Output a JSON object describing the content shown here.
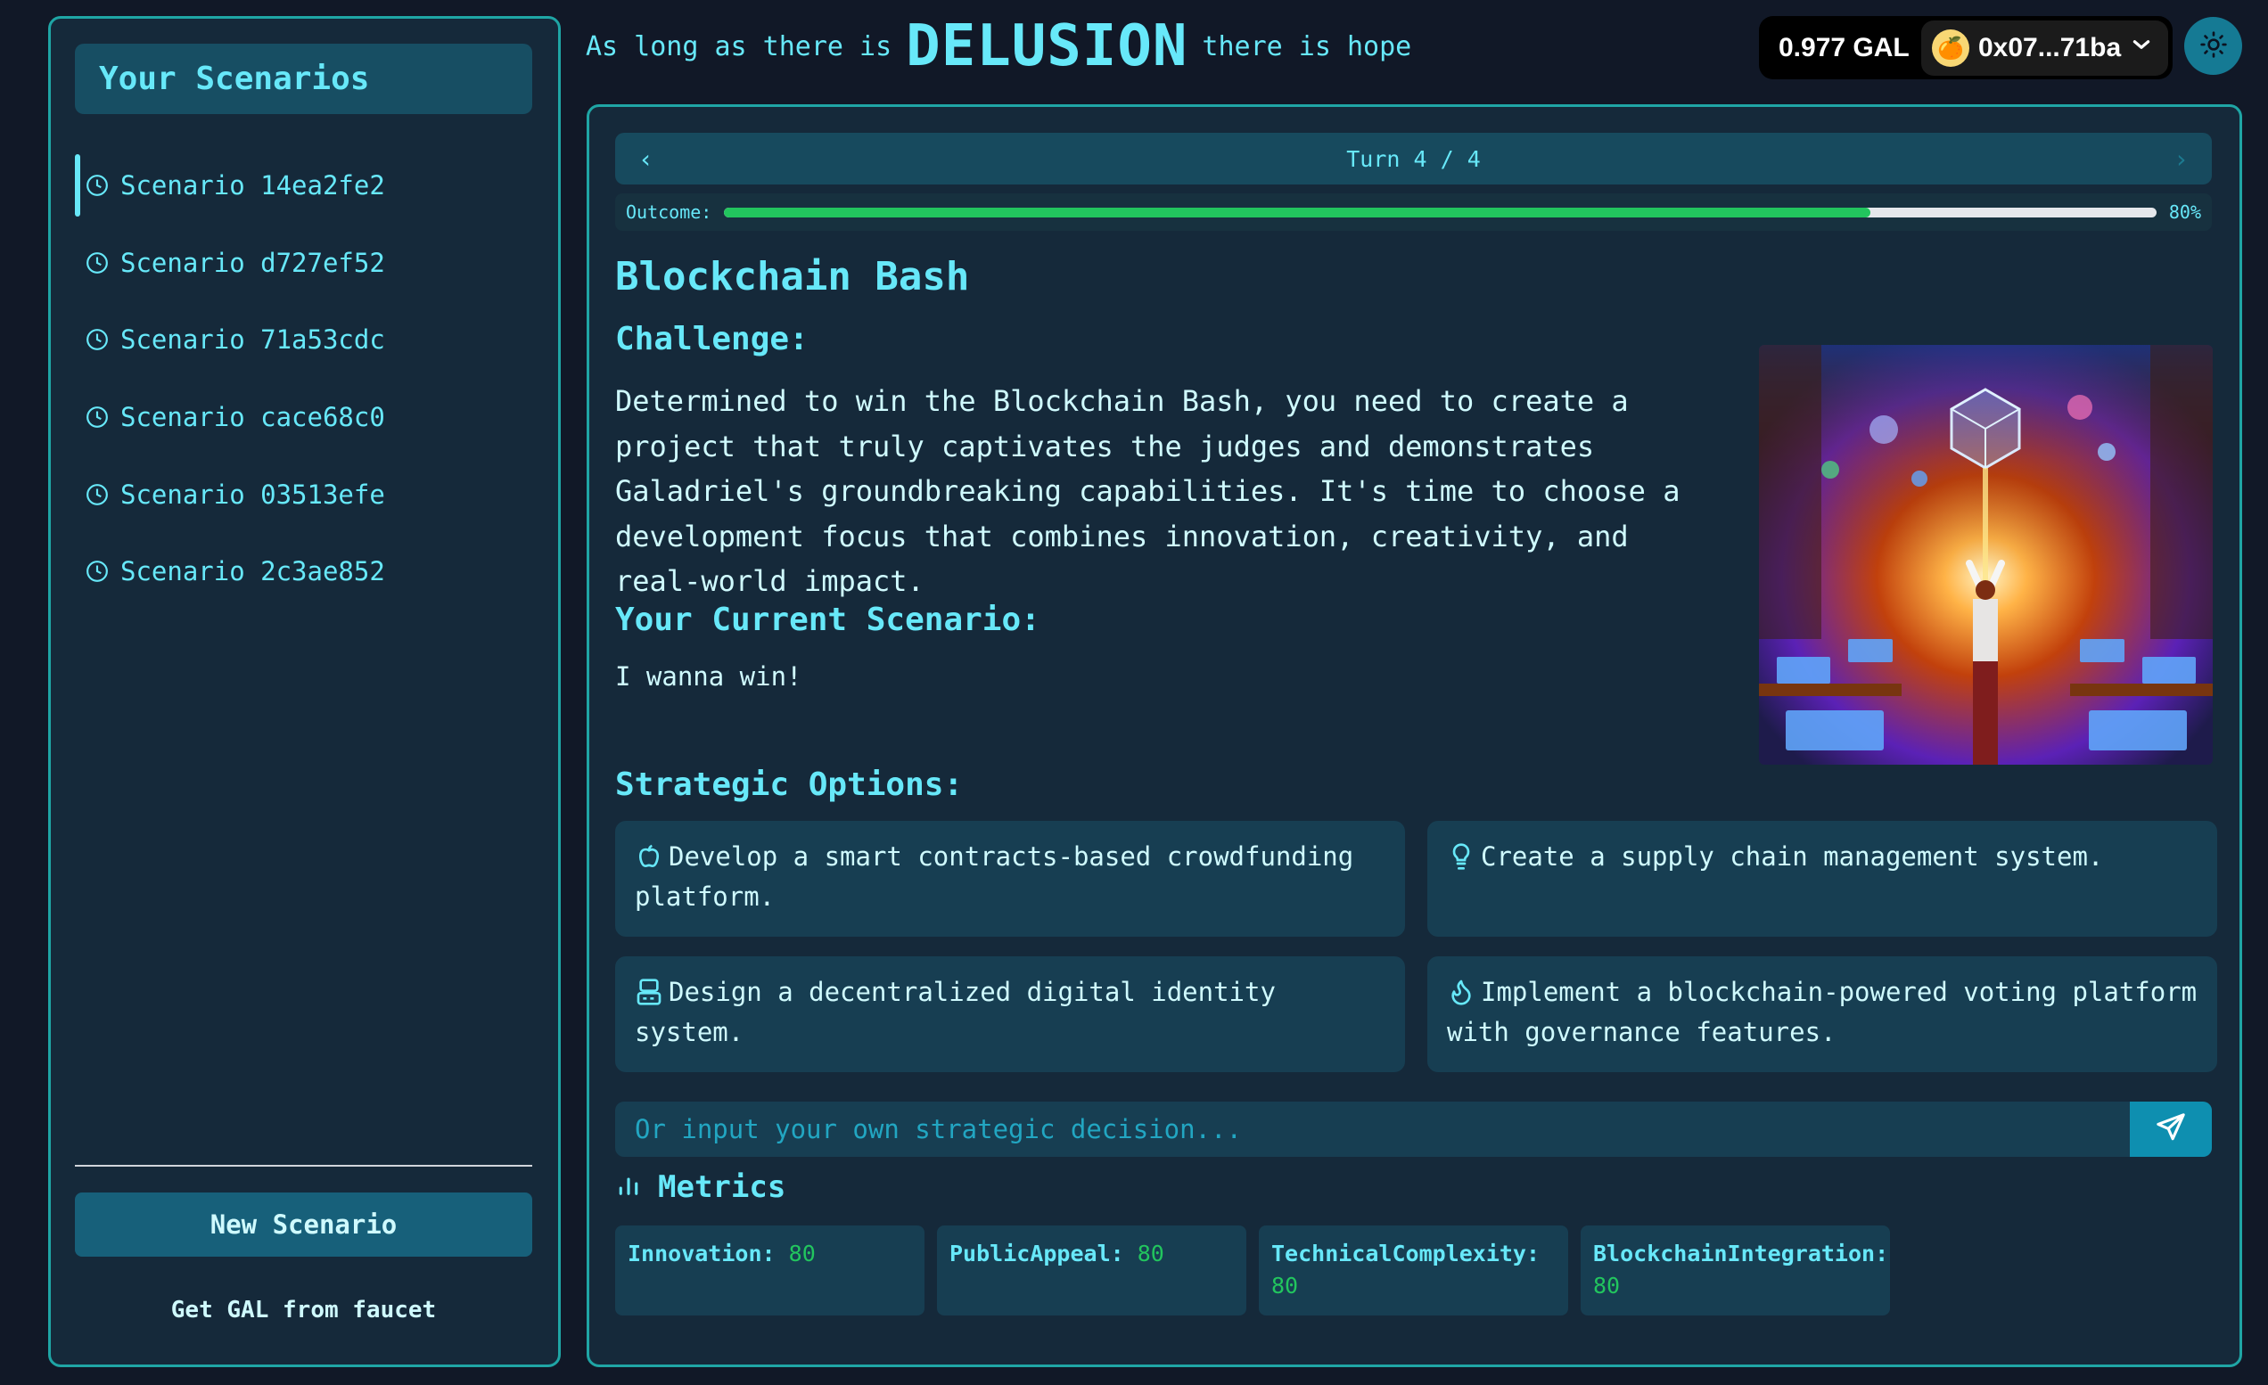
{
  "header": {
    "tagline_prefix": "As long as there is",
    "tagline_emphasis": "DELUSION",
    "tagline_suffix": "there is hope"
  },
  "wallet": {
    "balance": "0.977 GAL",
    "avatar_emoji": "🍊",
    "address": "0x07...71ba",
    "theme_toggle_icon": "sun-icon"
  },
  "sidebar": {
    "title": "Your Scenarios",
    "items": [
      {
        "label": "Scenario 14ea2fe2",
        "icon": "clock-icon",
        "active": true
      },
      {
        "label": "Scenario d727ef52",
        "icon": "clock-icon",
        "active": false
      },
      {
        "label": "Scenario 71a53cdc",
        "icon": "clock-icon",
        "active": false
      },
      {
        "label": "Scenario cace68c0",
        "icon": "clock-icon",
        "active": false
      },
      {
        "label": "Scenario 03513efe",
        "icon": "clock-icon",
        "active": false
      },
      {
        "label": "Scenario 2c3ae852",
        "icon": "clock-icon",
        "active": false
      }
    ],
    "new_button": "New Scenario",
    "faucet_link": "Get GAL from faucet"
  },
  "turn": {
    "label": "Turn 4 / 4",
    "prev_glyph": "‹",
    "next_glyph": "›"
  },
  "outcome": {
    "label": "Outcome:",
    "percent": 80,
    "percent_label": "80%"
  },
  "scenario": {
    "title": "Blockchain Bash",
    "challenge_heading": "Challenge:",
    "challenge_text": "Determined to win the Blockchain Bash, you need to create a project that truly captivates the judges and demonstrates Galadriel's groundbreaking capabilities. It's time to choose a development focus that combines innovation, creativity, and real-world impact.",
    "current_heading": "Your Current Scenario:",
    "current_text": "I wanna win!",
    "image_alt": "Hackathon hall with rows of developers at glowing monitors under a floating blockchain cube"
  },
  "options": {
    "heading": "Strategic Options:",
    "items": [
      {
        "icon": "apple-icon",
        "text": "Develop a smart contracts-based crowdfunding platform."
      },
      {
        "icon": "lightbulb-icon",
        "text": "Create a supply chain management system."
      },
      {
        "icon": "server-icon",
        "text": "Design a decentralized digital identity system."
      },
      {
        "icon": "flame-icon",
        "text": "Implement a blockchain-powered voting platform with governance features."
      }
    ]
  },
  "decision_input": {
    "placeholder": "Or input your own strategic decision...",
    "value": ""
  },
  "metrics": {
    "heading": "Metrics",
    "items": [
      {
        "name": "Innovation:",
        "value": "80"
      },
      {
        "name": "PublicAppeal:",
        "value": "80"
      },
      {
        "name": "TechnicalComplexity:",
        "value": "80"
      },
      {
        "name": "BlockchainIntegration:",
        "value": "80"
      }
    ]
  },
  "colors": {
    "accent": "#67e8f9",
    "border": "#1fa5a5",
    "panel": "#15293a",
    "progress": "#22c55e",
    "button": "#17607a"
  }
}
